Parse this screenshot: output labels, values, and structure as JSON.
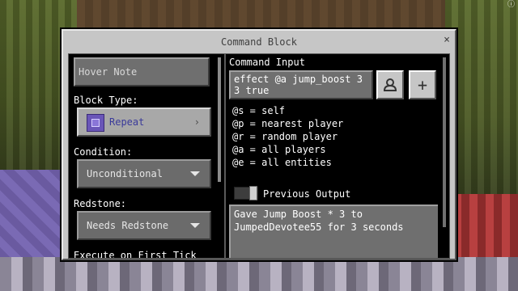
{
  "window": {
    "title": "Command Block",
    "close_glyph": "×"
  },
  "left": {
    "hover_note_placeholder": "Hover Note",
    "block_type_label": "Block Type:",
    "block_type_value": "Repeat",
    "block_type_arrow": "›",
    "condition_label": "Condition:",
    "condition_value": "Unconditional",
    "redstone_label": "Redstone:",
    "redstone_value": "Needs Redstone",
    "execute_label": "Execute on First Tick"
  },
  "right": {
    "command_input_label": "Command Input",
    "command_value_line1": "effect @a jump_boost 3",
    "command_value_line2": "3 true",
    "add_icon": "+",
    "selectors": [
      "@s = self",
      "@p = nearest player",
      "@r = random player",
      "@a = all players",
      "@e = all entities"
    ],
    "previous_output_label": "Previous Output",
    "output_line1": "Gave Jump Boost * 3 to",
    "output_line2": "JumpedDevotee55 for 3 seconds"
  },
  "colors": {
    "panel_bg": "#c6c6c6",
    "inner_bg": "#000000",
    "field_bg": "#6f6f6f",
    "text_light": "#ffffff"
  },
  "icons": {
    "block_type": "repeat-command-block-icon",
    "insert_selector": "entity-selector-icon",
    "add": "plus-icon"
  }
}
